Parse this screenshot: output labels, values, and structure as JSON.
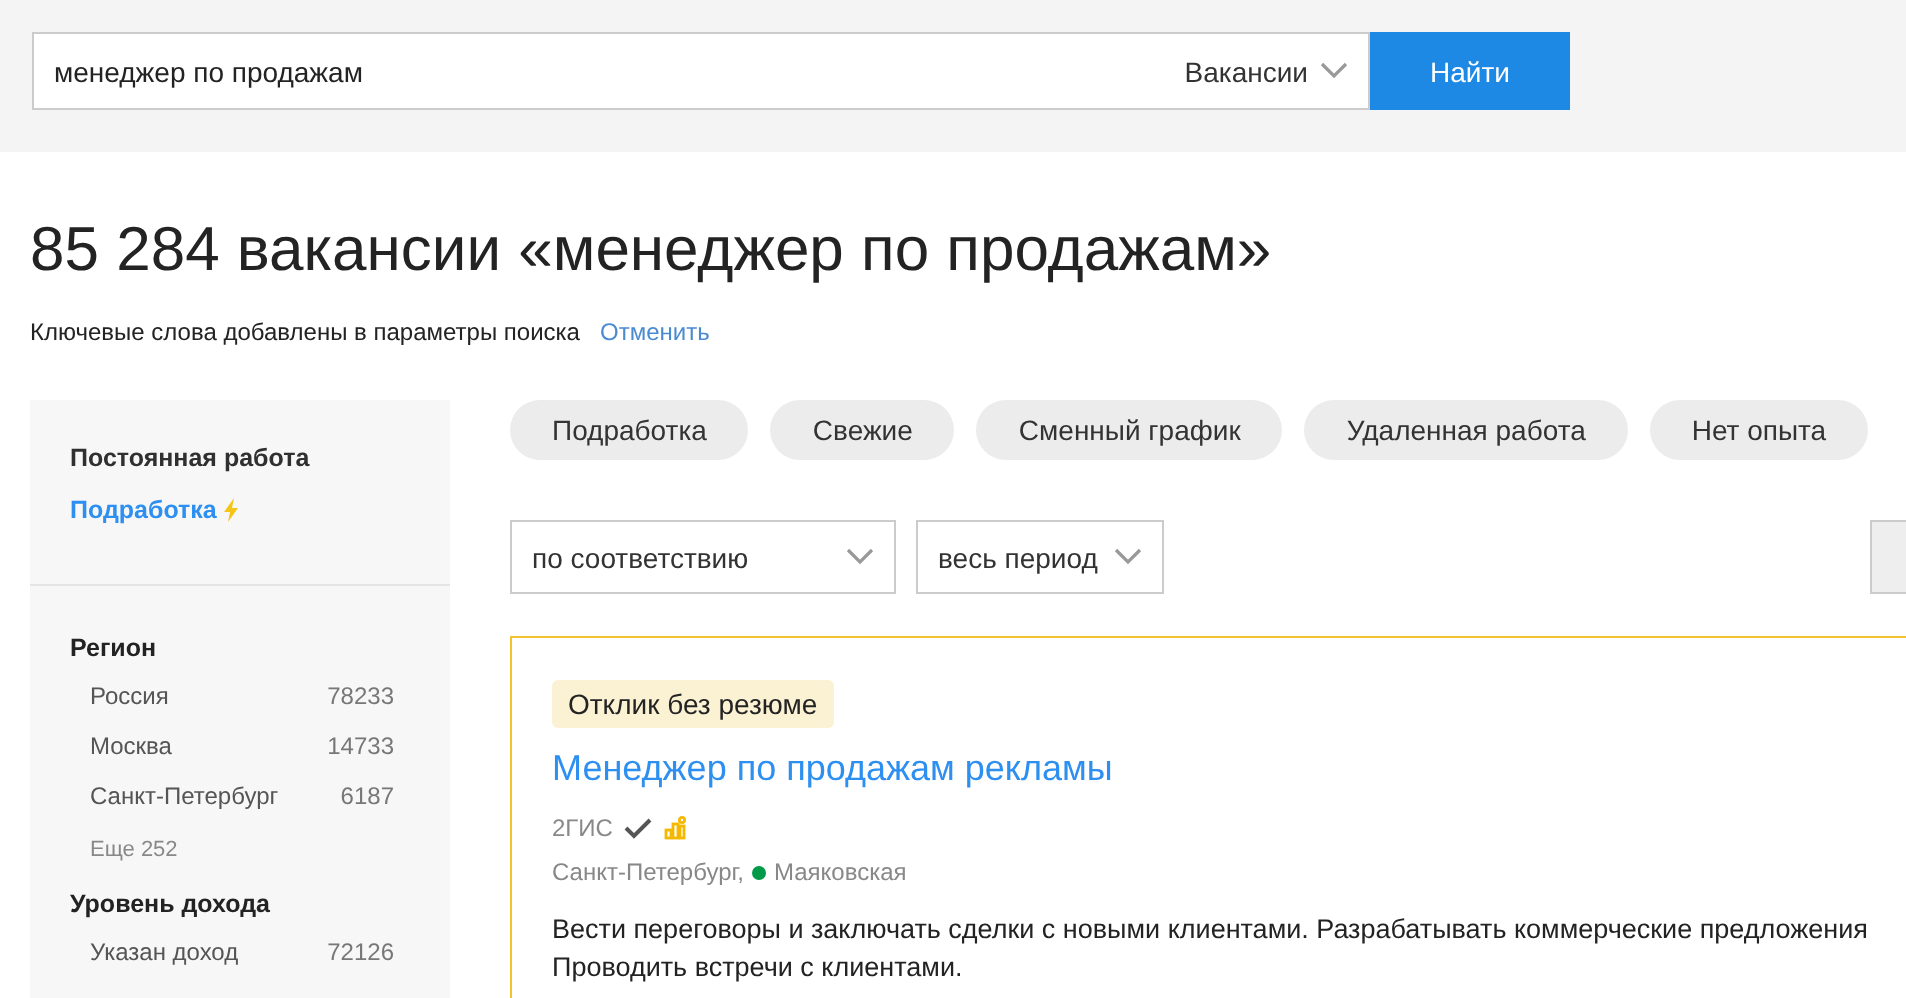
{
  "search": {
    "value": "менеджер по продажам",
    "scope": "Вакансии",
    "button": "Найти"
  },
  "heading": "85 284 вакансии «менеджер по продажам»",
  "notice": {
    "text": "Ключевые слова добавлены в параметры поиска",
    "link": "Отменить"
  },
  "sidebar": {
    "employment": [
      {
        "label": "Постоянная работа",
        "selected": true
      },
      {
        "label": "Подработка",
        "selected": false
      }
    ],
    "regions": {
      "title": "Регион",
      "items": [
        {
          "label": "Россия",
          "count": "78233"
        },
        {
          "label": "Москва",
          "count": "14733"
        },
        {
          "label": "Санкт-Петербург",
          "count": "6187"
        }
      ],
      "more": "Еще 252"
    },
    "income": {
      "title": "Уровень дохода",
      "items": [
        {
          "label": "Указан доход",
          "count": "72126"
        }
      ]
    }
  },
  "chips": [
    "Подработка",
    "Свежие",
    "Сменный график",
    "Удаленная работа",
    "Нет опыта"
  ],
  "sorts": [
    "по соответствию",
    "весь период"
  ],
  "vacancy": {
    "badge": "Отклик без резюме",
    "title": "Менеджер по продажам рекламы",
    "company": "2ГИС",
    "city": "Санкт-Петербург,",
    "metro": {
      "name": "Маяковская",
      "color": "#009a49"
    },
    "description": [
      "Вести переговоры и заключать сделки с новыми клиентами. Разрабатывать коммерческие предложения",
      "Проводить встречи с клиентами."
    ]
  }
}
